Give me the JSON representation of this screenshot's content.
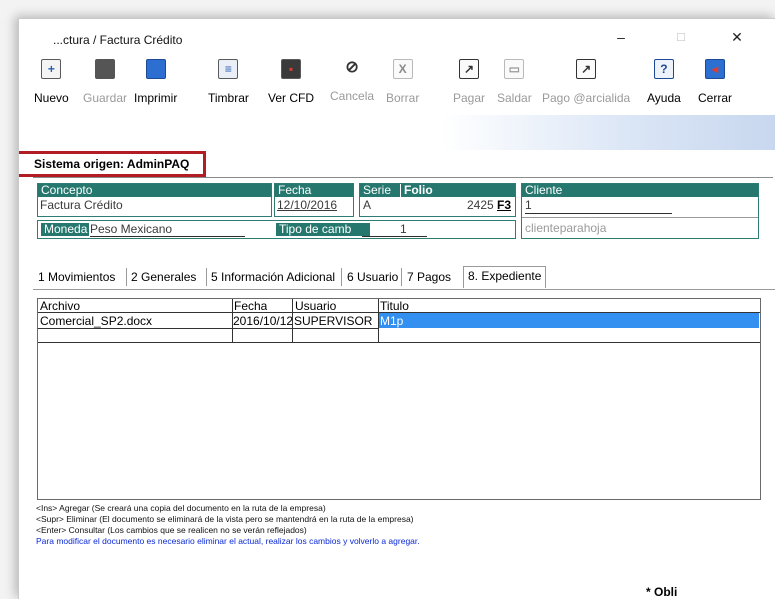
{
  "window": {
    "title": "...ctura / Factura Crédito"
  },
  "toolbar": {
    "items": [
      {
        "label": "Nuevo",
        "enabled": true
      },
      {
        "label": "Guardar",
        "enabled": false
      },
      {
        "label": "Imprimir",
        "enabled": true
      },
      {
        "label": "Timbrar",
        "enabled": true
      },
      {
        "label": "Ver CFD",
        "enabled": true
      },
      {
        "label": "Cancela",
        "enabled": false
      },
      {
        "label": "Borrar",
        "enabled": false
      },
      {
        "label": "Pagar",
        "enabled": false
      },
      {
        "label": "Saldar",
        "enabled": false
      },
      {
        "label": "Pago @arcialida",
        "enabled": false
      },
      {
        "label": "Ayuda",
        "enabled": true
      },
      {
        "label": "Cerrar",
        "enabled": true
      }
    ]
  },
  "origin": {
    "text": "Sistema origen: AdminPAQ"
  },
  "form": {
    "concepto_label": "Concepto",
    "concepto_value": "Factura Crédito",
    "fecha_label": "Fecha",
    "fecha_value": "12/10/2016",
    "serie_label": "Serie",
    "serie_value": "A",
    "folio_label": "Folio",
    "folio_value": "2425",
    "folio_f3": "F3",
    "cliente_label": "Cliente",
    "cliente_value": "1",
    "cliente_name": "clienteparahoja",
    "moneda_label": "Moneda",
    "moneda_value": "Peso Mexicano",
    "tipo_cambio_label": "Tipo de camb",
    "tipo_cambio_value": "1"
  },
  "tabs": [
    {
      "label": "1 Movimientos"
    },
    {
      "label": "2 Generales"
    },
    {
      "label": "5 Información Adicional"
    },
    {
      "label": "6 Usuario"
    },
    {
      "label": "7 Pagos"
    },
    {
      "label": "8. Expediente",
      "active": true
    }
  ],
  "table": {
    "columns": [
      "Archivo",
      "Fecha",
      "Usuario",
      "Titulo"
    ],
    "rows": [
      [
        "Comercial_SP2.docx",
        "2016/10/12",
        "SUPERVISOR",
        "M1p"
      ]
    ]
  },
  "help": {
    "line1": "<Ins> Agregar (Se creará una copia del documento en la ruta de la empresa)",
    "line2": "<Supr> Eliminar (El documento se eliminará de la vista pero se mantendrá en la ruta de la empresa)",
    "line3": "<Enter> Consultar (Los cambios que se realicen no se verán reflejados)",
    "line4": "Para modificar el documento es necesario eliminar el actual, realizar los cambios y volverlo a agregar.",
    "obligatorio": "* Obli"
  },
  "colors": {
    "teal": "#26786f",
    "selection": "#3390f0",
    "highlight": "#b11d23",
    "help_blue": "#0b29d6"
  }
}
